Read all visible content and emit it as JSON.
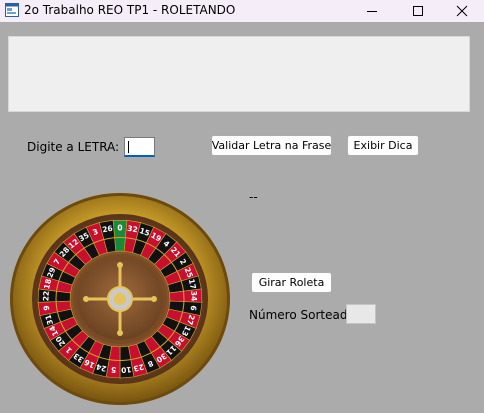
{
  "window": {
    "title": "2o Trabalho REO TP1 - ROLETANDO",
    "icon": "app-form-icon",
    "controls": [
      "minimize-icon",
      "maximize-icon",
      "close-icon"
    ]
  },
  "phrase_display": {
    "value": ""
  },
  "letter_input": {
    "label": "Digite a LETRA:",
    "value": ""
  },
  "buttons": {
    "validate": "Validar Letra na Frase",
    "hint": "Exibir Dica",
    "spin": "Girar Roleta"
  },
  "hint_text": "--",
  "drawn_number": {
    "label": "Número Sorteado:",
    "value": ""
  },
  "roulette": {
    "numbers": [
      "0",
      "32",
      "15",
      "19",
      "4",
      "21",
      "2",
      "25",
      "17",
      "34",
      "6",
      "27",
      "13",
      "36",
      "11",
      "30",
      "8",
      "23",
      "10",
      "5",
      "24",
      "16",
      "33",
      "1",
      "20",
      "14",
      "31",
      "9",
      "22",
      "18",
      "29",
      "7",
      "28",
      "12",
      "35",
      "3",
      "26"
    ],
    "colors": {
      "red": "#c8102e",
      "black": "#111111",
      "green": "#1a8a3a",
      "gold": "#d2a62c",
      "wood": "#8b5a33"
    }
  }
}
